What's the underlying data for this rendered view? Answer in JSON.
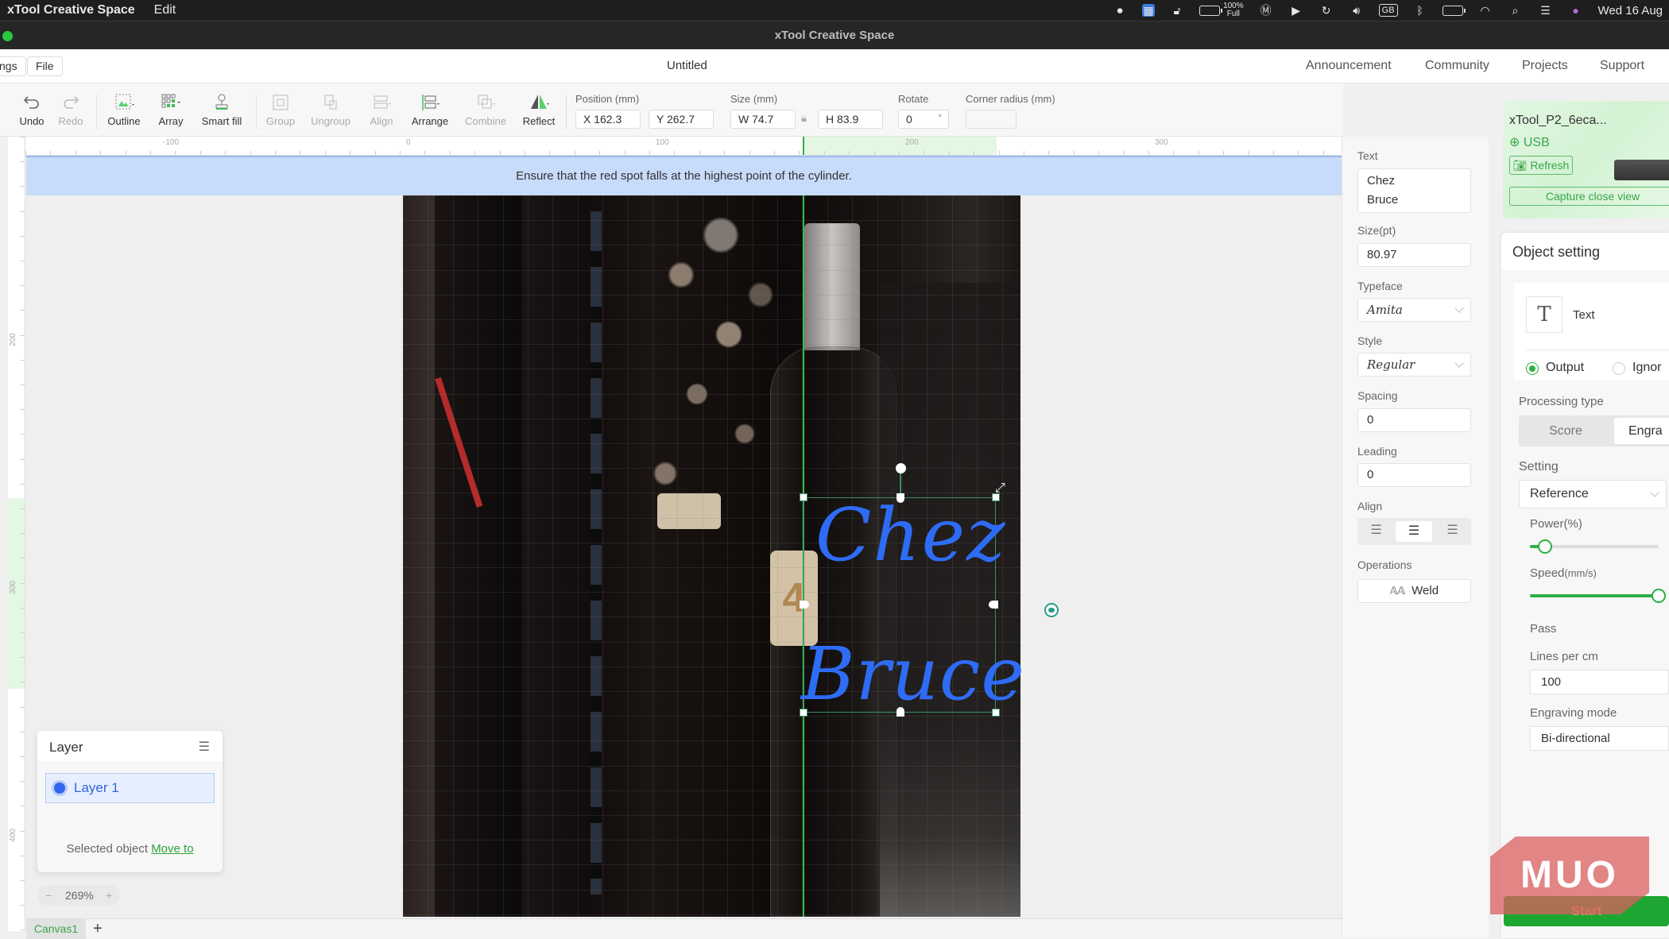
{
  "menubar": {
    "app_name": "xTool Creative Space",
    "menus": [
      "Edit"
    ],
    "battery_text_top": "100%",
    "battery_text_bottom": "Full",
    "input_source": "GB",
    "clock": "Wed 16 Aug"
  },
  "window": {
    "title": "xTool Creative Space"
  },
  "header": {
    "left_buttons": [
      "ngs",
      "File"
    ],
    "document_title": "Untitled",
    "nav": [
      "Announcement",
      "Community",
      "Projects",
      "Support"
    ]
  },
  "toolbar": {
    "tools": [
      {
        "label": "Undo",
        "icon": "undo-icon",
        "enabled": true
      },
      {
        "label": "Redo",
        "icon": "redo-icon",
        "enabled": false
      },
      {
        "label": "Outline",
        "icon": "outline-icon",
        "enabled": true
      },
      {
        "label": "Array",
        "icon": "array-icon",
        "enabled": true
      },
      {
        "label": "Smart fill",
        "icon": "smart-fill-icon",
        "enabled": true
      },
      {
        "label": "Group",
        "icon": "group-icon",
        "enabled": false
      },
      {
        "label": "Ungroup",
        "icon": "ungroup-icon",
        "enabled": false
      },
      {
        "label": "Align",
        "icon": "align-icon",
        "enabled": false
      },
      {
        "label": "Arrange",
        "icon": "arrange-icon",
        "enabled": true
      },
      {
        "label": "Combine",
        "icon": "combine-icon",
        "enabled": false
      },
      {
        "label": "Reflect",
        "icon": "reflect-icon",
        "enabled": true
      }
    ],
    "position_label": "Position (mm)",
    "x_value": "X 162.3",
    "y_value": "Y 262.7",
    "size_label": "Size (mm)",
    "w_value": "W 74.7",
    "h_value": "H 83.9",
    "rotate_label": "Rotate",
    "rotate_value": "0",
    "rotate_unit": "°",
    "corner_label": "Corner radius (mm)",
    "corner_value": ""
  },
  "rulers": {
    "top_labels": [
      "-100",
      "0",
      "100",
      "200",
      "300"
    ],
    "left_labels": [
      "200",
      "300",
      "400"
    ]
  },
  "banner": {
    "text": "Ensure that the red spot falls at the highest point of the cylinder."
  },
  "canvas": {
    "text_lines": [
      "Chez",
      "Bruce"
    ],
    "text_color": "#2f6cf6"
  },
  "layer_panel": {
    "title": "Layer",
    "layers": [
      "Layer 1"
    ],
    "footer_text": "Selected object",
    "footer_link": "Move to"
  },
  "zoom": {
    "minus": "−",
    "value": "269%",
    "plus": "+"
  },
  "tabs": {
    "items": [
      "Canvas1"
    ],
    "add": "+"
  },
  "text_props": {
    "text_label": "Text",
    "text_value_lines": [
      "Chez",
      "Bruce"
    ],
    "size_label": "Size(pt)",
    "size_value": "80.97",
    "typeface_label": "Typeface",
    "typeface_value": "Amita",
    "style_label": "Style",
    "style_value": "Regular",
    "spacing_label": "Spacing",
    "spacing_value": "0",
    "leading_label": "Leading",
    "leading_value": "0",
    "align_label": "Align",
    "align_options": [
      "left",
      "center",
      "right"
    ],
    "align_selected": "center",
    "operations_label": "Operations",
    "weld_label": "Weld"
  },
  "device": {
    "name": "xTool_P2_6eca...",
    "connection": "USB",
    "refresh_label": "Refresh",
    "capture_label": "Capture close view"
  },
  "object_setting": {
    "title": "Object setting",
    "object_type": "Text",
    "output_label": "Output",
    "ignore_label": "Ignor",
    "output_selected": true,
    "processing_label": "Processing type",
    "processing_options": [
      "Score",
      "Engra"
    ],
    "processing_selected": "Engra",
    "setting_label": "Setting",
    "setting_value": "Reference",
    "power_label": "Power(%)",
    "power_fraction": 0.12,
    "speed_label": "Speed",
    "speed_unit": "(mm/s)",
    "speed_fraction": 1.0,
    "pass_label": "Pass",
    "lines_label": "Lines per cm",
    "lines_value": "100",
    "mode_label": "Engraving mode",
    "mode_value": "Bi-directional"
  },
  "start_button": {
    "label": "Start"
  },
  "watermark": {
    "text": "MUO"
  },
  "colors": {
    "accent_green": "#2fae46",
    "banner_blue": "#c7dbfa",
    "layer_blue": "#3366dd"
  }
}
